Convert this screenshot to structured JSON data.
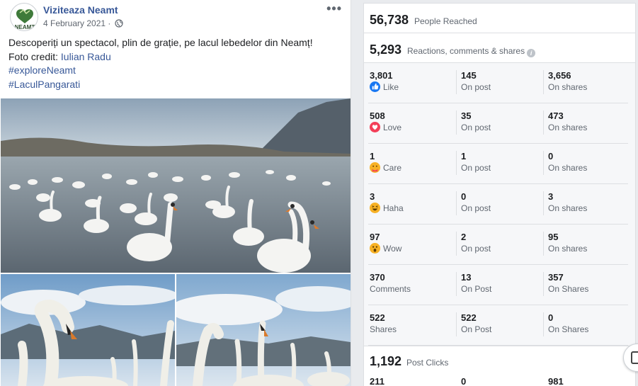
{
  "post": {
    "page_name": "Viziteaza Neamt",
    "avatar_text": "NEAMȚ",
    "date": "4 February 2021",
    "date_separator": " · ",
    "more_label": "•••",
    "text_line1": "Descoperiți un spectacol, plin de grație, pe lacul lebedelor din Neamț!",
    "credit_prefix": "Foto credit: ",
    "credit_name": "Iulian Radu",
    "hashtag1": "#exploreNeamt",
    "hashtag2": "#LaculPangarati"
  },
  "insights": {
    "reached_value": "56,738",
    "reached_label": "People Reached",
    "engagement_value": "5,293",
    "engagement_label": "Reactions, comments & shares",
    "info_icon": "i",
    "rows": [
      {
        "v1": "3,801",
        "t1": "Like",
        "icon": "like-icon",
        "color": "#1877f2",
        "v2": "145",
        "t2": "On post",
        "v3": "3,656",
        "t3": "On shares"
      },
      {
        "v1": "508",
        "t1": "Love",
        "icon": "love-icon",
        "color": "#f33e58",
        "v2": "35",
        "t2": "On post",
        "v3": "473",
        "t3": "On shares"
      },
      {
        "v1": "1",
        "t1": "Care",
        "icon": "care-icon",
        "color": "#f7b125",
        "v2": "1",
        "t2": "On post",
        "v3": "0",
        "t3": "On shares"
      },
      {
        "v1": "3",
        "t1": "Haha",
        "icon": "haha-icon",
        "color": "#f7b125",
        "v2": "0",
        "t2": "On post",
        "v3": "3",
        "t3": "On shares"
      },
      {
        "v1": "97",
        "t1": "Wow",
        "icon": "wow-icon",
        "color": "#f7b125",
        "v2": "2",
        "t2": "On post",
        "v3": "95",
        "t3": "On shares"
      },
      {
        "v1": "370",
        "t1": "Comments",
        "icon": "",
        "color": "",
        "v2": "13",
        "t2": "On Post",
        "v3": "357",
        "t3": "On Shares"
      },
      {
        "v1": "522",
        "t1": "Shares",
        "icon": "",
        "color": "",
        "v2": "522",
        "t2": "On Post",
        "v3": "0",
        "t3": "On Shares"
      }
    ],
    "clicks_value": "1,192",
    "clicks_label": "Post Clicks",
    "clicks_sub": [
      "211",
      "0",
      "981"
    ]
  }
}
